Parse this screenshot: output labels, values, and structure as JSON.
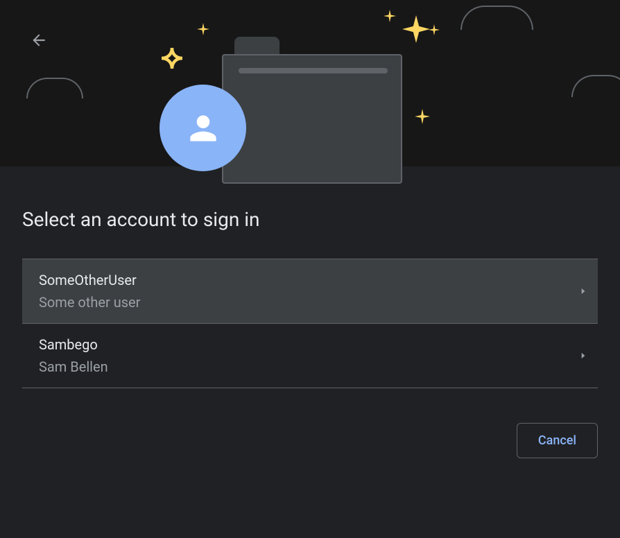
{
  "title": "Select an account to sign in",
  "accounts": [
    {
      "username": "SomeOtherUser",
      "displayName": "Some other user",
      "highlighted": true
    },
    {
      "username": "Sambego",
      "displayName": "Sam Bellen",
      "highlighted": false
    }
  ],
  "buttons": {
    "cancel": "Cancel"
  },
  "colors": {
    "background": "#202124",
    "heroBackground": "#171717",
    "accent": "#8ab4f8",
    "sparkle": "#fdd663",
    "textPrimary": "#e8eaed",
    "textSecondary": "#9aa0a6",
    "border": "#5f6368",
    "surfaceHighlight": "#3c4043"
  }
}
